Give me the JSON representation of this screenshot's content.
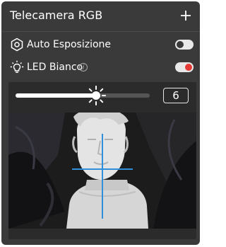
{
  "header": {
    "title": "Telecamera RGB",
    "add_icon": "plus-icon"
  },
  "rows": {
    "auto_exposure": {
      "label": "Auto Esposizione",
      "icon": "aperture-icon",
      "enabled": false
    },
    "white_led": {
      "label": "LED Bianco",
      "icon": "bulb-icon",
      "info_glyph": "i",
      "enabled": true
    }
  },
  "brightness": {
    "value": "6",
    "level": 0.6,
    "icon": "sun-icon"
  },
  "camera": {
    "alt": "bust-statue-with-crosshair"
  },
  "colors": {
    "panel_bg": "#3a3a3a",
    "toggle_off": "#e8e8e8",
    "toggle_on": "#e8e8e8",
    "toggle_knob_on": "#e53935",
    "toggle_knob_off": "#3a3a3a",
    "crosshair": "#2f8fdb"
  }
}
